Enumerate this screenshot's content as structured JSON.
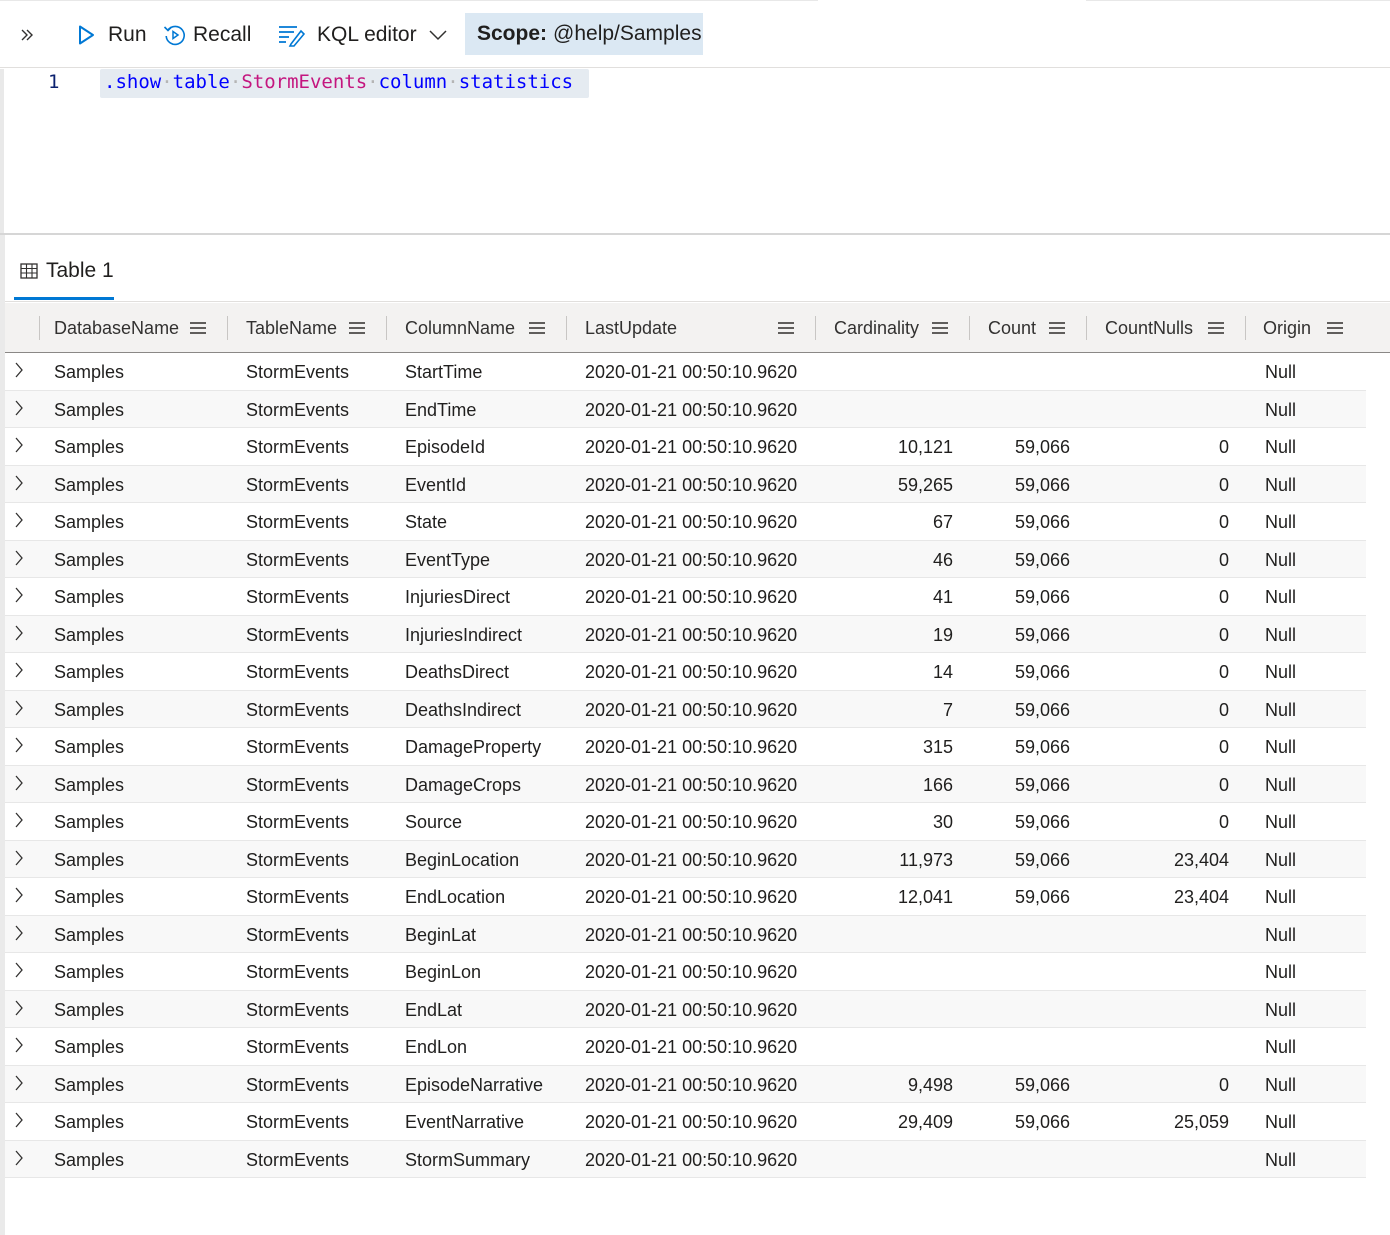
{
  "toolbar": {
    "run_label": "Run",
    "recall_label": "Recall",
    "editor_mode_label": "KQL editor",
    "scope_key": "Scope:",
    "scope_value": "@help/Samples",
    "accent_color": "#0078d4",
    "scope_bg": "#dbe8f3"
  },
  "editor": {
    "line_number": "1",
    "tokens": {
      "show": ".show",
      "table": "table",
      "table_name": "StormEvents",
      "column": "column",
      "statistics": "statistics"
    }
  },
  "results": {
    "tab_label": "Table 1",
    "columns": [
      "DatabaseName",
      "TableName",
      "ColumnName",
      "LastUpdate",
      "Cardinality",
      "Count",
      "CountNulls",
      "Origin"
    ],
    "rows": [
      [
        "Samples",
        "StormEvents",
        "StartTime",
        "2020-01-21 00:50:10.9620",
        "",
        "",
        "",
        "Null"
      ],
      [
        "Samples",
        "StormEvents",
        "EndTime",
        "2020-01-21 00:50:10.9620",
        "",
        "",
        "",
        "Null"
      ],
      [
        "Samples",
        "StormEvents",
        "EpisodeId",
        "2020-01-21 00:50:10.9620",
        "10,121",
        "59,066",
        "0",
        "Null"
      ],
      [
        "Samples",
        "StormEvents",
        "EventId",
        "2020-01-21 00:50:10.9620",
        "59,265",
        "59,066",
        "0",
        "Null"
      ],
      [
        "Samples",
        "StormEvents",
        "State",
        "2020-01-21 00:50:10.9620",
        "67",
        "59,066",
        "0",
        "Null"
      ],
      [
        "Samples",
        "StormEvents",
        "EventType",
        "2020-01-21 00:50:10.9620",
        "46",
        "59,066",
        "0",
        "Null"
      ],
      [
        "Samples",
        "StormEvents",
        "InjuriesDirect",
        "2020-01-21 00:50:10.9620",
        "41",
        "59,066",
        "0",
        "Null"
      ],
      [
        "Samples",
        "StormEvents",
        "InjuriesIndirect",
        "2020-01-21 00:50:10.9620",
        "19",
        "59,066",
        "0",
        "Null"
      ],
      [
        "Samples",
        "StormEvents",
        "DeathsDirect",
        "2020-01-21 00:50:10.9620",
        "14",
        "59,066",
        "0",
        "Null"
      ],
      [
        "Samples",
        "StormEvents",
        "DeathsIndirect",
        "2020-01-21 00:50:10.9620",
        "7",
        "59,066",
        "0",
        "Null"
      ],
      [
        "Samples",
        "StormEvents",
        "DamageProperty",
        "2020-01-21 00:50:10.9620",
        "315",
        "59,066",
        "0",
        "Null"
      ],
      [
        "Samples",
        "StormEvents",
        "DamageCrops",
        "2020-01-21 00:50:10.9620",
        "166",
        "59,066",
        "0",
        "Null"
      ],
      [
        "Samples",
        "StormEvents",
        "Source",
        "2020-01-21 00:50:10.9620",
        "30",
        "59,066",
        "0",
        "Null"
      ],
      [
        "Samples",
        "StormEvents",
        "BeginLocation",
        "2020-01-21 00:50:10.9620",
        "11,973",
        "59,066",
        "23,404",
        "Null"
      ],
      [
        "Samples",
        "StormEvents",
        "EndLocation",
        "2020-01-21 00:50:10.9620",
        "12,041",
        "59,066",
        "23,404",
        "Null"
      ],
      [
        "Samples",
        "StormEvents",
        "BeginLat",
        "2020-01-21 00:50:10.9620",
        "",
        "",
        "",
        "Null"
      ],
      [
        "Samples",
        "StormEvents",
        "BeginLon",
        "2020-01-21 00:50:10.9620",
        "",
        "",
        "",
        "Null"
      ],
      [
        "Samples",
        "StormEvents",
        "EndLat",
        "2020-01-21 00:50:10.9620",
        "",
        "",
        "",
        "Null"
      ],
      [
        "Samples",
        "StormEvents",
        "EndLon",
        "2020-01-21 00:50:10.9620",
        "",
        "",
        "",
        "Null"
      ],
      [
        "Samples",
        "StormEvents",
        "EpisodeNarrative",
        "2020-01-21 00:50:10.9620",
        "9,498",
        "59,066",
        "0",
        "Null"
      ],
      [
        "Samples",
        "StormEvents",
        "EventNarrative",
        "2020-01-21 00:50:10.9620",
        "29,409",
        "59,066",
        "25,059",
        "Null"
      ],
      [
        "Samples",
        "StormEvents",
        "StormSummary",
        "2020-01-21 00:50:10.9620",
        "",
        "",
        "",
        "Null"
      ]
    ]
  }
}
